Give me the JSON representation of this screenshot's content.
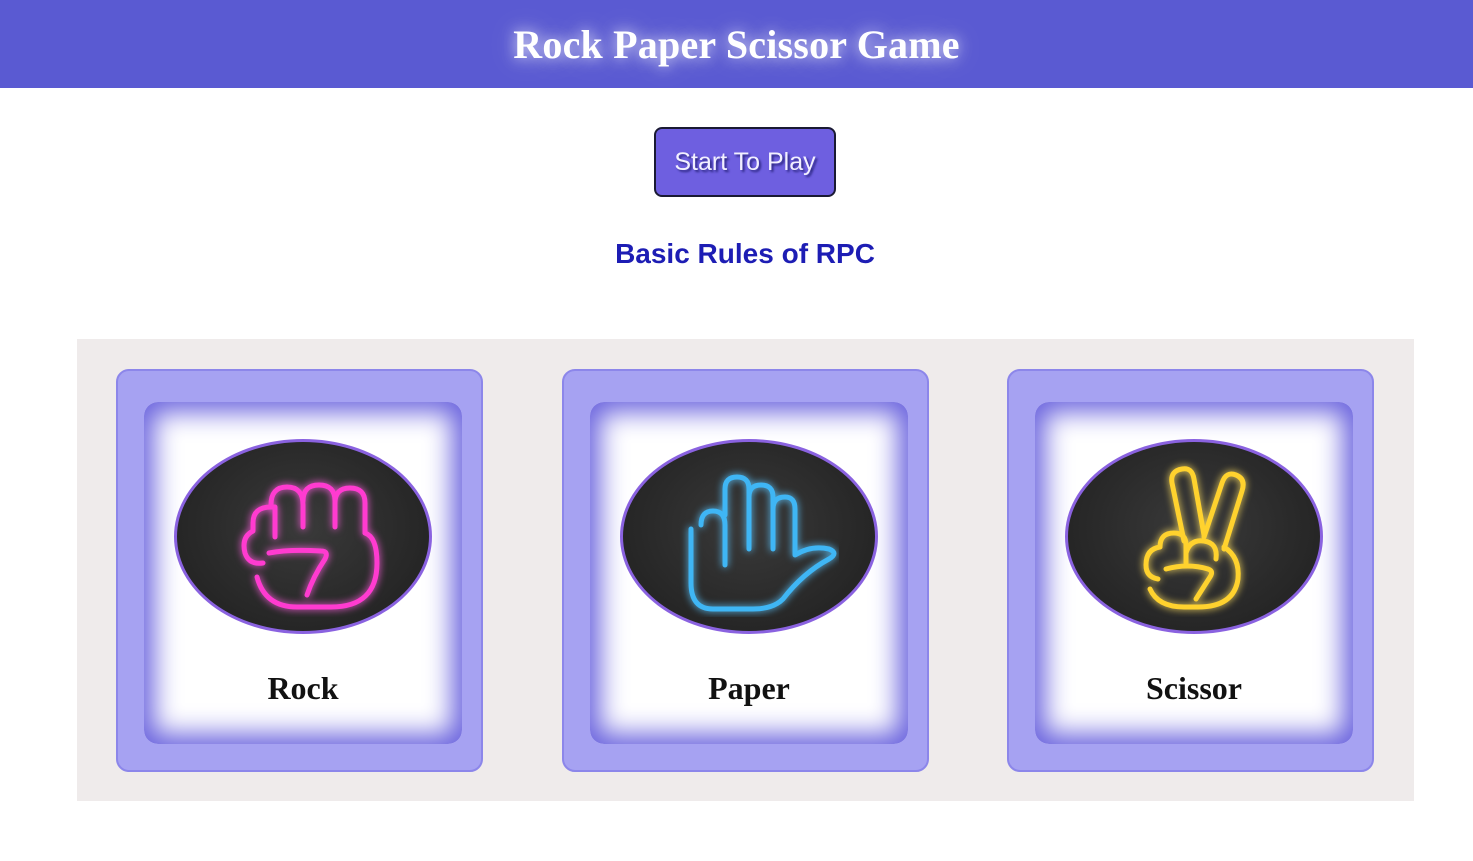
{
  "header": {
    "title": "Rock Paper Scissor Game"
  },
  "start_button": {
    "label": "Start To Play"
  },
  "rules": {
    "title": "Basic Rules of RPC"
  },
  "cards": [
    {
      "label": "Rock",
      "icon": "rock-fist-icon",
      "glow_color": "#f15dcb"
    },
    {
      "label": "Paper",
      "icon": "paper-hand-icon",
      "glow_color": "#3fb6f5"
    },
    {
      "label": "Scissor",
      "icon": "scissor-hand-icon",
      "glow_color": "#f5c93a"
    }
  ],
  "colors": {
    "header_bg": "#5a5ad2",
    "button_bg": "#6e5fe0",
    "rules_title": "#1d1db4",
    "card_bg": "#a6a2f2",
    "panel_bg": "#efebeb"
  }
}
